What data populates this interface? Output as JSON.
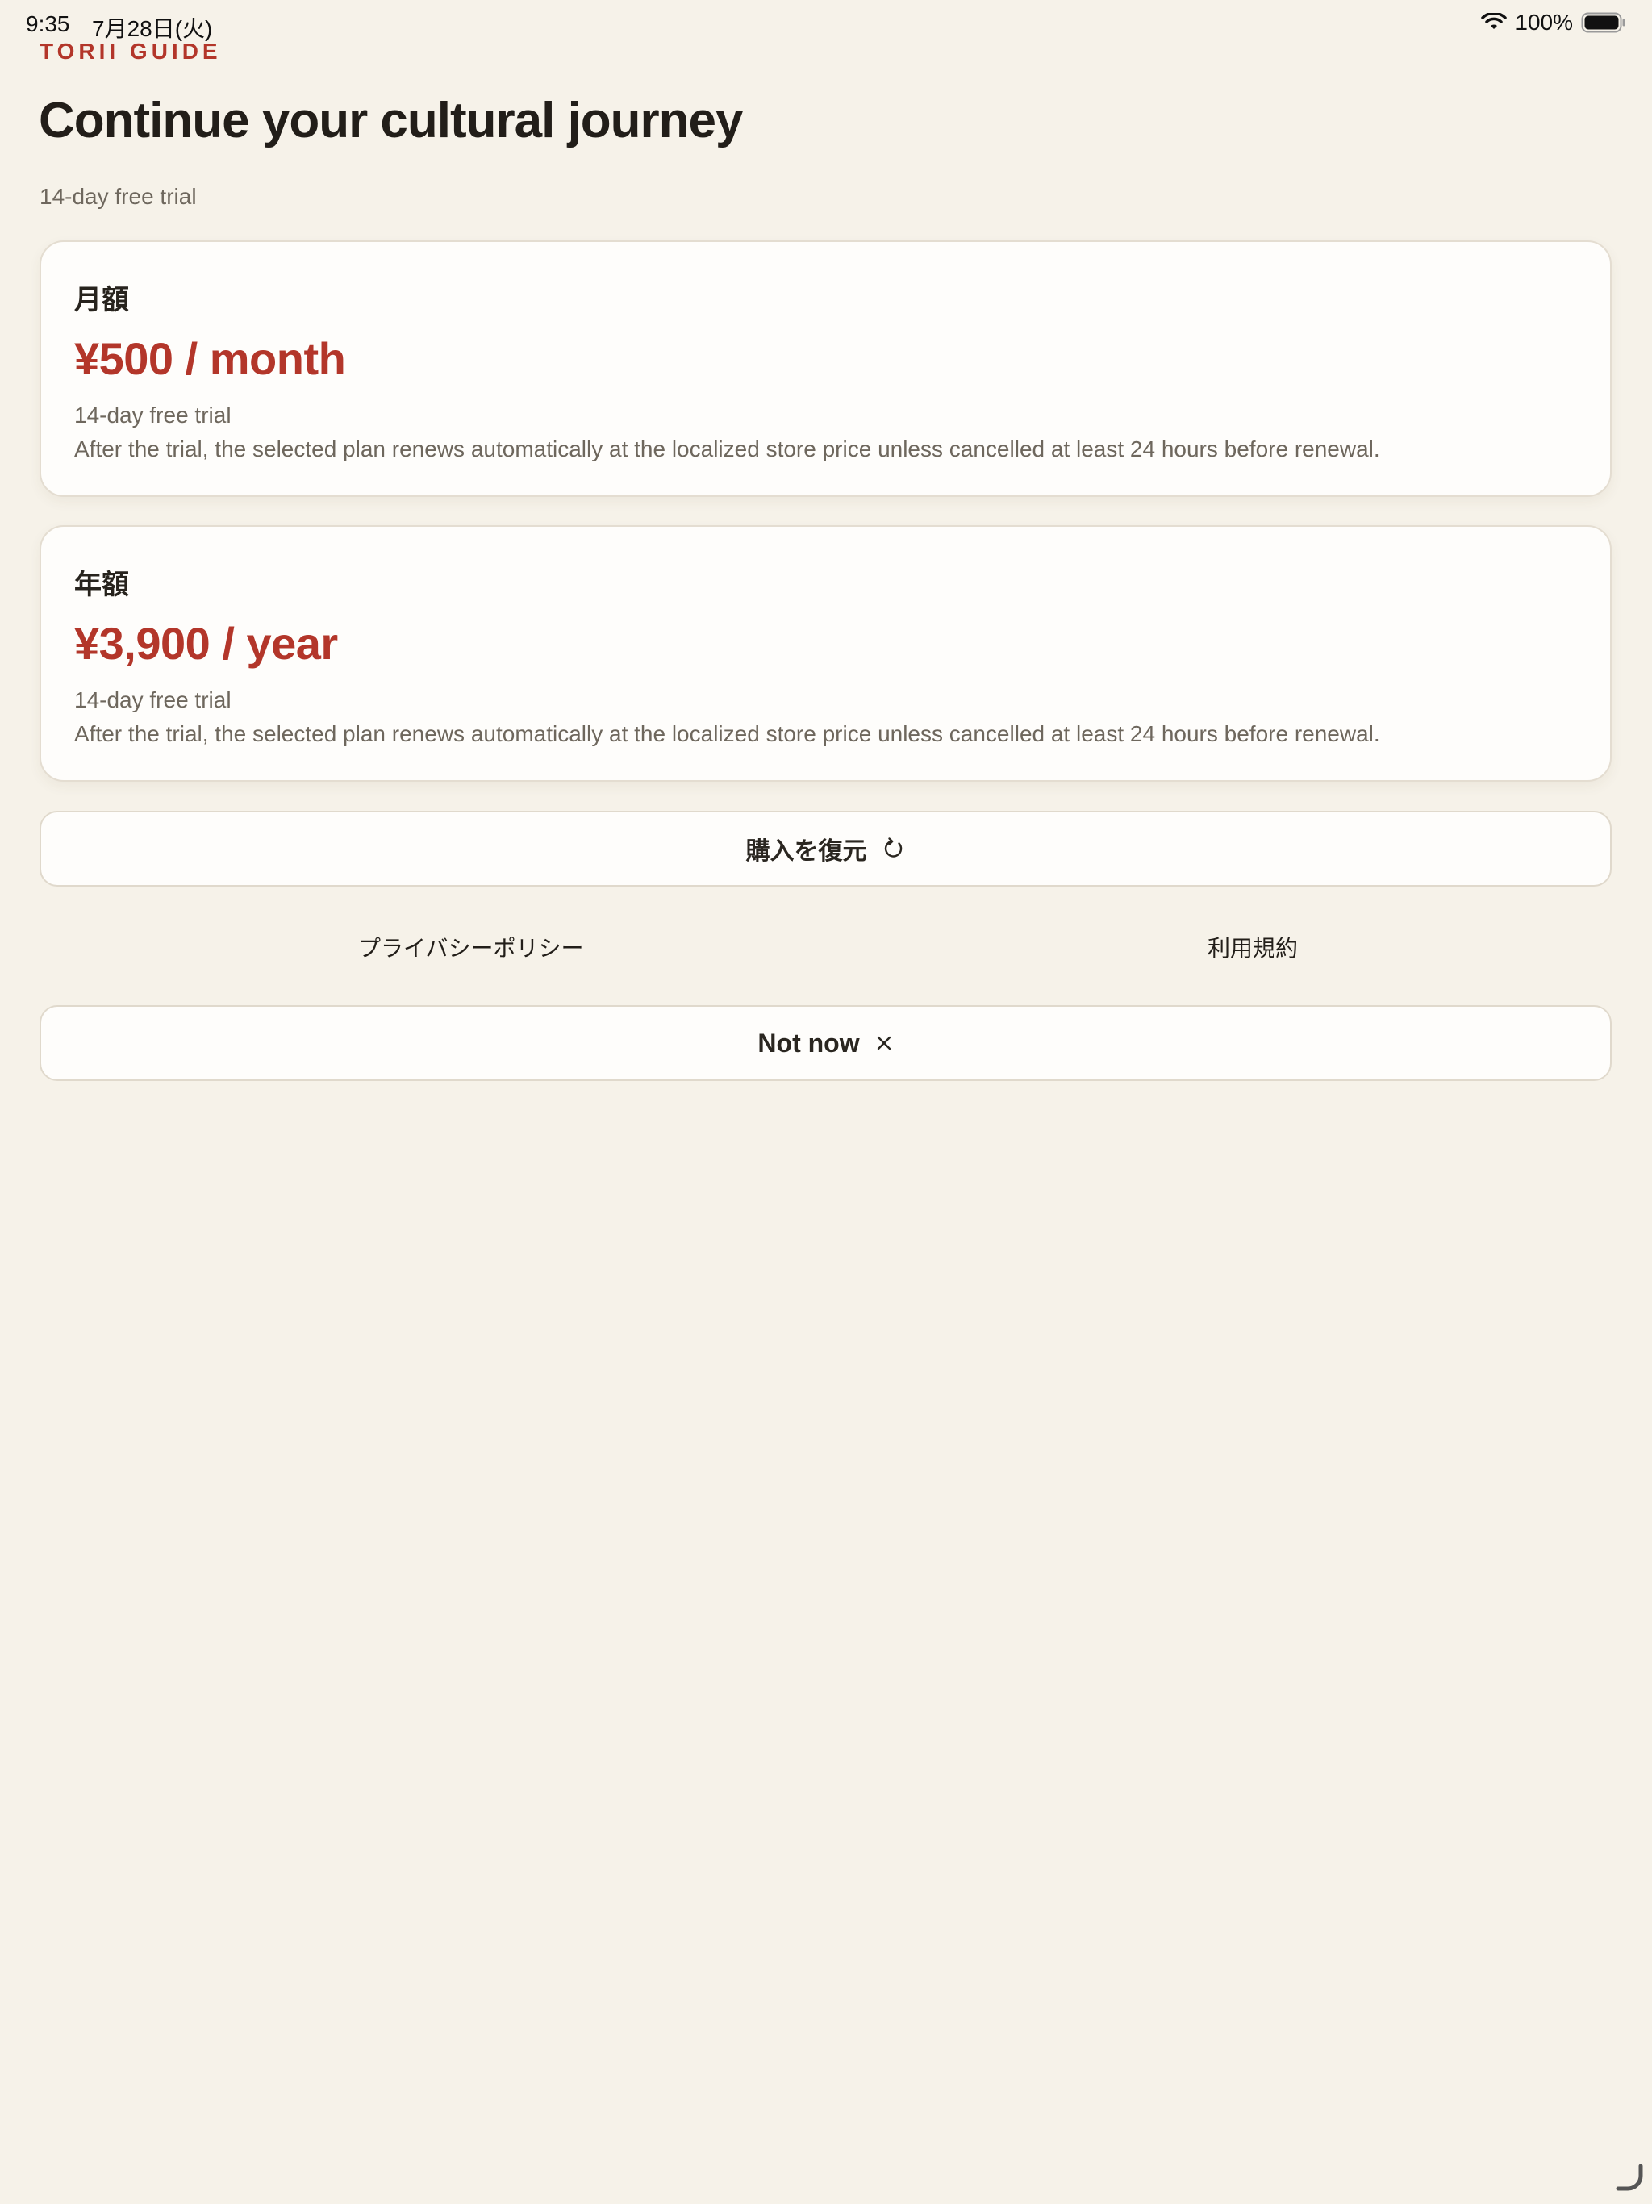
{
  "status_bar": {
    "time": "9:35",
    "date": "7月28日(火)",
    "battery_percent": "100%",
    "icons": [
      "wifi-icon",
      "battery-icon"
    ]
  },
  "brand": "TORII GUIDE",
  "title": "Continue your cultural journey",
  "subtitle": "14-day free trial",
  "plans": [
    {
      "name": "月額",
      "price": "¥500 / month",
      "trial": "14-day free trial",
      "note": "After the trial, the selected plan renews automatically at the localized store price unless cancelled at least 24 hours before renewal."
    },
    {
      "name": "年額",
      "price": "¥3,900 / year",
      "trial": "14-day free trial",
      "note": "After the trial, the selected plan renews automatically at the localized store price unless cancelled at least 24 hours before renewal."
    }
  ],
  "restore_button": {
    "label": "購入を復元",
    "icon": "refresh-icon"
  },
  "links": {
    "privacy": "プライバシーポリシー",
    "terms": "利用規約"
  },
  "dismiss_button": {
    "label": "Not now",
    "icon": "close-icon"
  },
  "colors": {
    "background": "#f6f2e9",
    "accent": "#b3362a",
    "card": "#fefdfb",
    "text": "#221e19",
    "muted": "#6e675d"
  }
}
